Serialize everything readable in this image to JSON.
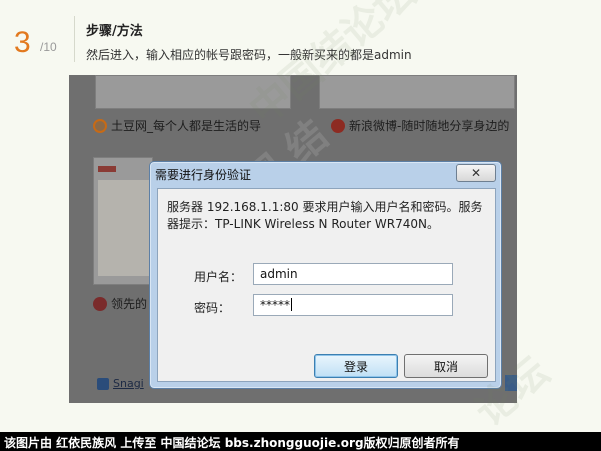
{
  "step": {
    "number": "3",
    "total": "/10",
    "title": "步骤/方法",
    "description": "然后进入，输入相应的帐号跟密码，一般新买来的都是admin"
  },
  "background": {
    "links": [
      "土豆网_每个人都是生活的导",
      "新浪微博-随时随地分享身边的",
      "领先的",
      "Snagi"
    ]
  },
  "dialog": {
    "title": "需要进行身份验证",
    "close_label": "✕",
    "message": "服务器 192.168.1.1:80 要求用户输入用户名和密码。服务器提示：TP-LINK Wireless N Router WR740N。",
    "username_label": "用户名：",
    "username_value": "admin",
    "password_label": "密码：",
    "password_value": "*****",
    "login_label": "登录",
    "cancel_label": "取消"
  },
  "footer": {
    "text": "该图片由 红依民族风 上传至 中国结论坛 bbs.zhongguojie.org版权归原创者所有"
  }
}
